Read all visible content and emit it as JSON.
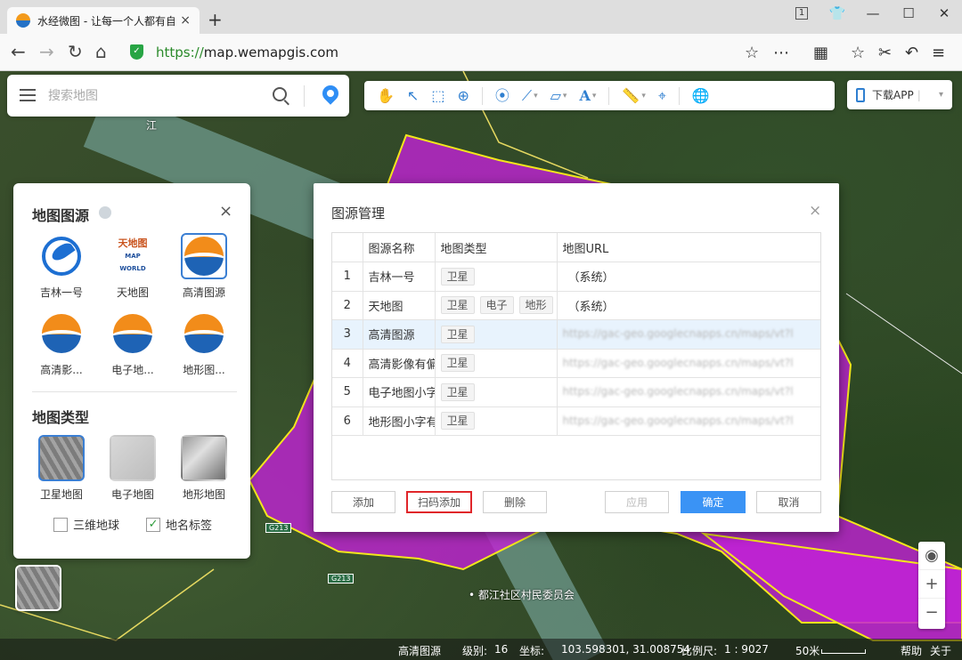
{
  "browser": {
    "tab_title": "水经微图 - 让每一个人都有自",
    "tab_close": "×",
    "new_tab": "+",
    "window_num": "1",
    "url_scheme": "https://",
    "url_host": "map.wemapgis.com"
  },
  "search": {
    "placeholder": "搜索地图"
  },
  "download_app": {
    "label": "下载APP",
    "sep": "|",
    "caret": "▾"
  },
  "source_panel": {
    "title": "地图图源",
    "close": "×",
    "sources": [
      {
        "label": "吉林一号",
        "icon": "jilin-logo"
      },
      {
        "label": "天地图",
        "icon": "tianditu-logo",
        "logo_text": "天地图",
        "logo_sub": "MAP WORLD"
      },
      {
        "label": "高清图源",
        "icon": "hd-logo",
        "selected": true
      },
      {
        "label": "高清影...",
        "icon": "hd-logo"
      },
      {
        "label": "电子地...",
        "icon": "hd-logo"
      },
      {
        "label": "地形图...",
        "icon": "hd-logo"
      }
    ],
    "types_title": "地图类型",
    "types": [
      {
        "label": "卫星地图",
        "selected": true
      },
      {
        "label": "电子地图"
      },
      {
        "label": "地形地图"
      }
    ],
    "check_3d": {
      "label": "三维地球",
      "checked": false
    },
    "check_labels": {
      "label": "地名标签",
      "checked": true,
      "mark": "✓"
    }
  },
  "dialog": {
    "title": "图源管理",
    "close": "×",
    "columns": [
      "",
      "图源名称",
      "地图类型",
      "地图URL"
    ],
    "rows": [
      {
        "num": "1",
        "name": "吉林一号",
        "types": [
          "卫星"
        ],
        "url": "（系统）",
        "blurred": false
      },
      {
        "num": "2",
        "name": "天地图",
        "types": [
          "卫星",
          "电子",
          "地形"
        ],
        "url": "（系统）",
        "blurred": false
      },
      {
        "num": "3",
        "name": "高清图源",
        "types": [
          "卫星"
        ],
        "url": "https://gac-geo.googlecnapps.cn/maps/vt?l",
        "blurred": true,
        "highlight": true
      },
      {
        "num": "4",
        "name": "高清影像有偏",
        "types": [
          "卫星"
        ],
        "url": "https://gac-geo.googlecnapps.cn/maps/vt?l",
        "blurred": true
      },
      {
        "num": "5",
        "name": "电子地图小字",
        "types": [
          "卫星"
        ],
        "url": "https://gac-geo.googlecnapps.cn/maps/vt?l",
        "blurred": true
      },
      {
        "num": "6",
        "name": "地形图小字有",
        "types": [
          "卫星"
        ],
        "url": "https://gac-geo.googlecnapps.cn/maps/vt?l",
        "blurred": true
      }
    ],
    "buttons": {
      "add": "添加",
      "scan_add": "扫码添加",
      "delete": "删除",
      "apply": "应用",
      "ok": "确定",
      "cancel": "取消"
    }
  },
  "map_labels": {
    "village": "都江社区村民委员会",
    "road": "G213",
    "river_mark": "江"
  },
  "zoom": {
    "locate": "◉",
    "in": "+",
    "out": "−"
  },
  "status": {
    "source": "高清图源",
    "level_label": "级别:",
    "level": "16",
    "coord_label": "坐标:",
    "coord": "103.598301, 31.008754",
    "scale_label": "比例尺:",
    "scale": "1 : 9027",
    "scalebar": "50米",
    "help": "帮助",
    "about": "关于"
  },
  "colors": {
    "accent": "#3a93f5",
    "highlight_row": "#e8f3fd",
    "overlay": "#c222d6",
    "overlay_border": "#f3e61c",
    "red_outline": "#e0262a"
  }
}
